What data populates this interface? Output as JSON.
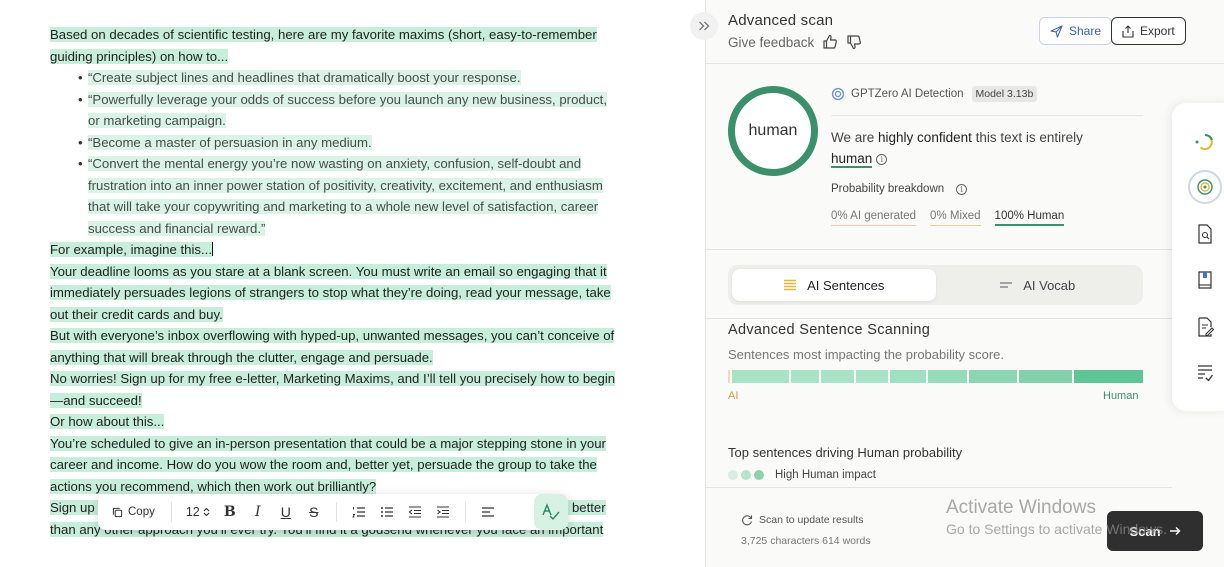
{
  "editor": {
    "intro": "Based on decades of scientific testing, here are my favorite maxims (short, easy-to-remember guiding principles) on how to...",
    "bullets": [
      "“Create subject lines and headlines that dramatically boost your response.",
      "“Powerfully leverage your odds of success before you launch any new business, product, or marketing campaign.",
      "“Become a master of persuasion in any medium.",
      "“Convert the mental energy you’re now wasting on anxiety, confusion, self-doubt and frustration into an inner power station of positivity, creativity, excitement, and enthusiasm that will take your copywriting and marketing to a whole new level of satisfaction, career success and financial reward.”"
    ],
    "p_example": "For example, imagine this...",
    "p_deadline": "Your deadline looms as you stare at a blank screen. You must write an email so engaging that it immediately persuades legions of strangers to stop what they’re doing, read your message, take out their credit cards and buy.",
    "p_inbox": "But with everyone’s inbox overflowing with hyped-up, unwanted messages, you can’t conceive of anything that will break through the clutter, engage and persuade.",
    "p_worries_a": "No worries! ",
    "p_worries_b": "Sign up for my free e-letter, Marketing Maxims, and I’ll tell you precisely how to begin—and succeed!",
    "p_how": "Or how about this...",
    "p_present_a": "You’re scheduled to give an in-person presentation that could be a major stepping stone in your career and income. ",
    "p_present_b": "How do you wow the room and, better yet, persuade the group to take the actions you recommend, which then work out brilliantly?",
    "p_signup_a": "Sign up",
    "p_signup_b": " ...e e...                                                                    ...vo sentence that is the foundation of all successful persuasion. It works better than any other approach you’ll ever try. ",
    "p_signup_c": "You’ll find it a godsend whenever you face an important"
  },
  "toolbar": {
    "copy_label": "Copy",
    "font_size": "12",
    "bold": "B",
    "italic": "I",
    "underline": "U",
    "strike": "S"
  },
  "panel": {
    "title": "Advanced scan",
    "feedback_label": "Give feedback",
    "share_label": "Share",
    "export_label": "Export",
    "ring_label": "human",
    "detector_name": "GPTZero AI Detection",
    "model_badge": "Model 3.13b",
    "verdict_pre": "We are ",
    "verdict_strong": "highly confident",
    "verdict_post": " this text is entirely",
    "verdict_result": "human",
    "prob_label": "Probability breakdown",
    "prob_ai": "0% AI generated",
    "prob_mixed": "0% Mixed",
    "prob_human": "100% Human",
    "tab_sentences": "AI Sentences",
    "tab_vocab": "AI Vocab",
    "scan_title": "Advanced Sentence Scanning",
    "scan_sub": "Sentences most impacting the probability score.",
    "spectrum_ai": "AI",
    "spectrum_human": "Human",
    "top_title": "Top sentences driving Human probability",
    "impact_label": "High Human impact",
    "footer_scan": "Scan to update results",
    "footer_count": "3,725 characters 614 words",
    "scan_button": "Scan"
  },
  "watermark": {
    "line1": "Activate Windows",
    "line2": "Go to Settings to activate Windows."
  },
  "colors": {
    "highlight": "#c7eedb",
    "accent_green": "#3b8f6a",
    "ai_orange": "#d49a4a"
  },
  "spectrum_segments": [
    {
      "weight": 0.5,
      "color": "#f2d9b8"
    },
    {
      "weight": 14,
      "color": "#a8e3c8"
    },
    {
      "weight": 7,
      "color": "#a8e3c8"
    },
    {
      "weight": 8,
      "color": "#a8e3c8"
    },
    {
      "weight": 8,
      "color": "#a8e3c8"
    },
    {
      "weight": 9,
      "color": "#9fdfc2"
    },
    {
      "weight": 9.5,
      "color": "#96dbbb"
    },
    {
      "weight": 12,
      "color": "#8dd6b4"
    },
    {
      "weight": 13,
      "color": "#82d0ac"
    },
    {
      "weight": 17,
      "color": "#5fc596"
    }
  ]
}
